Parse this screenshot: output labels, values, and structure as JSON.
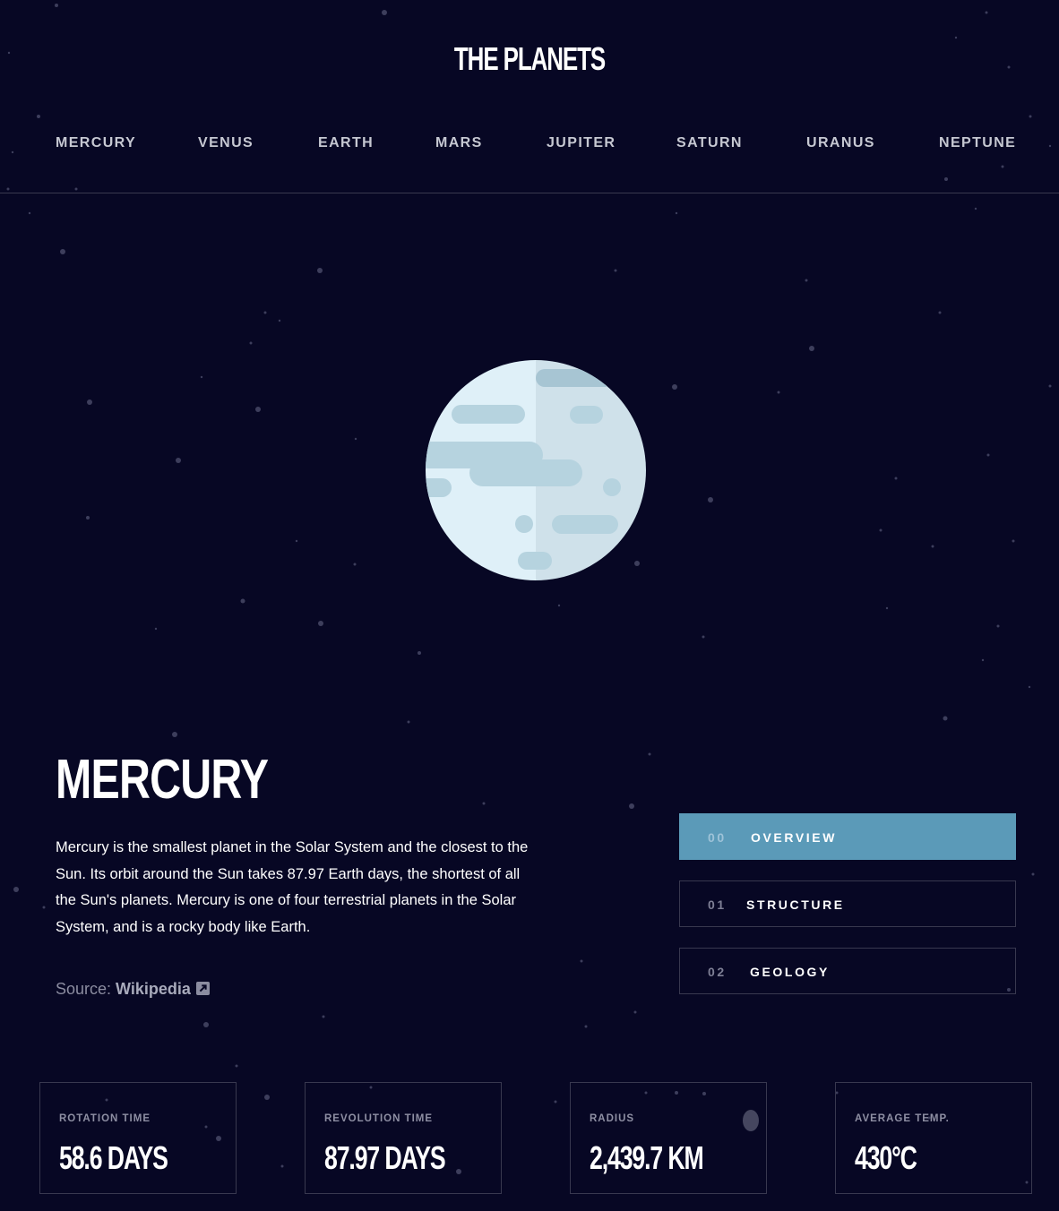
{
  "site": {
    "logo": "THE PLANETS"
  },
  "nav": {
    "items": [
      {
        "label": "MERCURY"
      },
      {
        "label": "VENUS"
      },
      {
        "label": "EARTH"
      },
      {
        "label": "MARS"
      },
      {
        "label": "JUPITER"
      },
      {
        "label": "SATURN"
      },
      {
        "label": "URANUS"
      },
      {
        "label": "NEPTUNE"
      }
    ]
  },
  "planet": {
    "name": "MERCURY",
    "image_icon": "planet-mercury-illustration",
    "description": "Mercury is the smallest planet in the Solar System and the closest to the Sun. Its orbit around the Sun takes 87.97 Earth days, the shortest of all the Sun's planets. Mercury is one of four terrestrial planets in the Solar System, and is a rocky body like Earth.",
    "source_label": "Source: ",
    "source_link": "Wikipedia",
    "source_icon": "external-link-icon"
  },
  "tabs": [
    {
      "number": "00",
      "label": "OVERVIEW",
      "active": true
    },
    {
      "number": "01",
      "label": "STRUCTURE",
      "active": false
    },
    {
      "number": "02",
      "label": "GEOLOGY",
      "active": false
    }
  ],
  "stats": [
    {
      "label": "ROTATION TIME",
      "value": "58.6 DAYS"
    },
    {
      "label": "REVOLUTION TIME",
      "value": "87.97 DAYS"
    },
    {
      "label": "RADIUS",
      "value": "2,439.7 KM"
    },
    {
      "label": "AVERAGE TEMP.",
      "value": "430°C"
    }
  ],
  "colors": {
    "background": "#070724",
    "accent": "#5b9ab8",
    "border": "#38384f",
    "planet_light": "#dff0f8",
    "planet_shadow": "#cfe1ea",
    "planet_crater": "#aac9d8"
  }
}
